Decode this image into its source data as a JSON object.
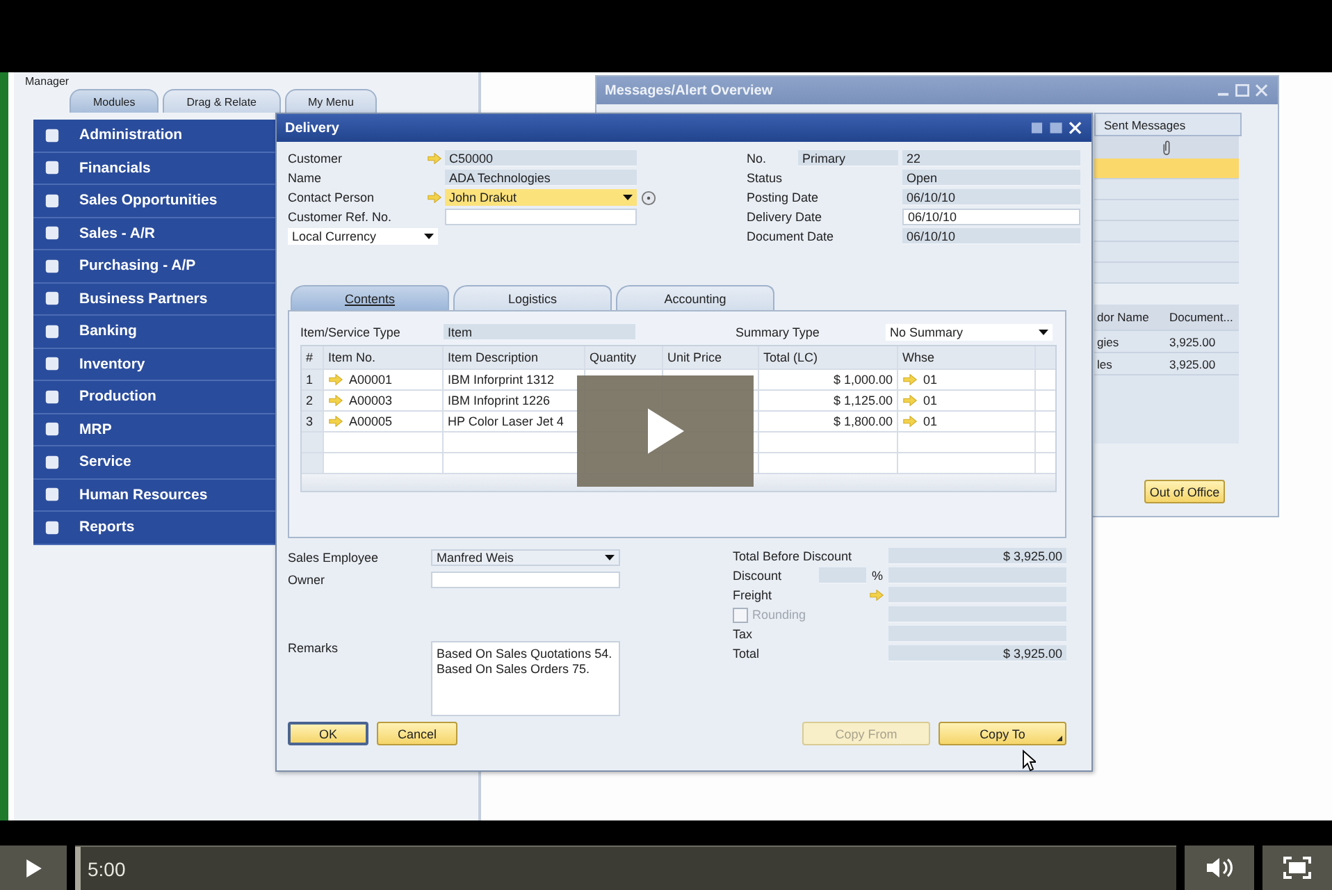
{
  "manager": {
    "title": "Manager",
    "tabs": [
      {
        "label": "Modules",
        "selected": true
      },
      {
        "label": "Drag & Relate",
        "selected": false
      },
      {
        "label": "My Menu",
        "selected": false
      }
    ],
    "modules": [
      "Administration",
      "Financials",
      "Sales Opportunities",
      "Sales - A/R",
      "Purchasing - A/P",
      "Business Partners",
      "Banking",
      "Inventory",
      "Production",
      "MRP",
      "Service",
      "Human Resources",
      "Reports"
    ]
  },
  "messages_window": {
    "title": "Messages/Alert Overview",
    "tabs": [
      {
        "label": "Sent Messages",
        "selected": false
      }
    ],
    "message_rows": [
      {
        "selected": true
      },
      {
        "selected": false
      },
      {
        "selected": false
      },
      {
        "selected": false
      },
      {
        "selected": false
      },
      {
        "selected": false
      }
    ],
    "alert_columns": [
      "dor Name",
      "Document..."
    ],
    "alert_rows": [
      [
        "gies",
        "3,925.00"
      ],
      [
        "les",
        "3,925.00"
      ]
    ],
    "button": "Out of Office"
  },
  "delivery": {
    "title": "Delivery",
    "left_fields": [
      {
        "label": "Customer",
        "value": "C50000",
        "link": true,
        "kind": "readonly"
      },
      {
        "label": "Name",
        "value": "ADA Technologies",
        "link": false,
        "kind": "readonly"
      },
      {
        "label": "Contact Person",
        "value": "John Drakut",
        "link": true,
        "kind": "dropdown"
      },
      {
        "label": "Customer Ref. No.",
        "link": false,
        "kind": "input"
      }
    ],
    "currency": "Local Currency",
    "right_fields": [
      {
        "label": "No.",
        "series": "Primary",
        "value": "22",
        "kind": "readonly"
      },
      {
        "label": "Status",
        "value": "Open",
        "kind": "readonly"
      },
      {
        "label": "Posting Date",
        "value": "06/10/10",
        "kind": "readonly"
      },
      {
        "label": "Delivery Date",
        "value": "06/10/10",
        "kind": "input"
      },
      {
        "label": "Document Date",
        "value": "06/10/10",
        "kind": "readonly"
      }
    ],
    "tabs": [
      {
        "label": "Contents",
        "selected": true
      },
      {
        "label": "Logistics",
        "selected": false
      },
      {
        "label": "Accounting",
        "selected": false
      }
    ],
    "item_type": {
      "label": "Item/Service Type",
      "value": "Item"
    },
    "summary_type": {
      "label": "Summary Type",
      "value": "No Summary"
    },
    "columns": [
      "#",
      "Item No.",
      "Item Description",
      "Quantity",
      "Unit Price",
      "Total (LC)",
      "Whse"
    ],
    "rows": [
      {
        "num": "1",
        "item_no": "A00001",
        "description": "IBM Inforprint 1312",
        "total": "$ 1,000.00",
        "whse": "01"
      },
      {
        "num": "2",
        "item_no": "A00003",
        "description": "IBM Infoprint 1226",
        "total": "$ 1,125.00",
        "whse": "01"
      },
      {
        "num": "3",
        "item_no": "A00005",
        "description": "HP Color Laser Jet 4",
        "total": "$ 1,800.00",
        "whse": "01"
      }
    ],
    "sales_employee": {
      "label": "Sales Employee",
      "value": "Manfred Weis"
    },
    "owner": {
      "label": "Owner"
    },
    "remarks": {
      "label": "Remarks",
      "lines": [
        "Based On Sales Quotations 54.",
        "Based On Sales Orders 75."
      ]
    },
    "totals": [
      {
        "label": "Total Before Discount",
        "value": "$ 3,925.00",
        "kind": "readonly"
      },
      {
        "label": "Discount",
        "unit": "%",
        "kind": "percent"
      },
      {
        "label": "Freight",
        "kind": "link"
      },
      {
        "label": "Rounding",
        "kind": "checkbox",
        "checked": false,
        "disabled": true
      },
      {
        "label": "Tax",
        "kind": "readonly"
      },
      {
        "label": "Total",
        "value": "$ 3,925.00",
        "kind": "readonly"
      }
    ],
    "buttons_left": [
      {
        "label": "OK",
        "disabled": false,
        "default": true
      },
      {
        "label": "Cancel",
        "disabled": false,
        "default": false
      }
    ],
    "buttons_right": [
      {
        "label": "Copy From",
        "disabled": true,
        "menu": false
      },
      {
        "label": "Copy To",
        "disabled": false,
        "menu": true
      }
    ]
  },
  "player": {
    "time": "5:00",
    "level": 0
  }
}
